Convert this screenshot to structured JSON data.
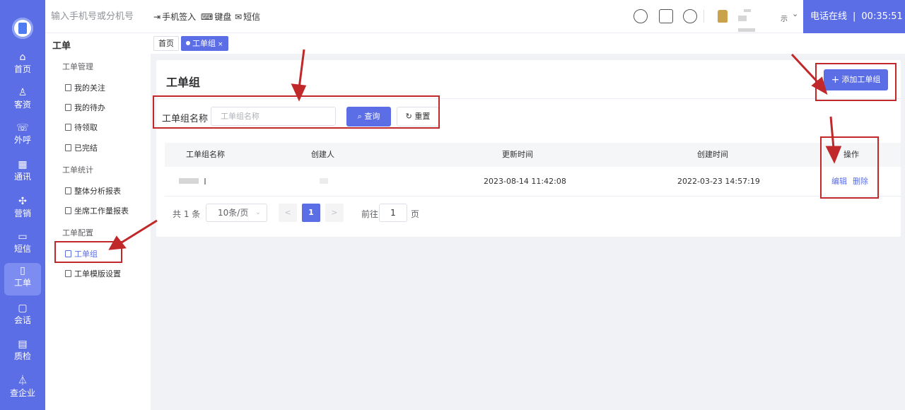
{
  "rail": {
    "items": [
      {
        "label": "首页",
        "icon": "home-icon"
      },
      {
        "label": "客资",
        "icon": "customer-icon"
      },
      {
        "label": "外呼",
        "icon": "outbound-call-icon"
      },
      {
        "label": "通讯",
        "icon": "contacts-icon"
      },
      {
        "label": "营销",
        "icon": "marketing-icon"
      },
      {
        "label": "短信",
        "icon": "sms-icon"
      },
      {
        "label": "工单",
        "icon": "ticket-icon",
        "active": true
      },
      {
        "label": "会话",
        "icon": "chat-icon"
      },
      {
        "label": "质检",
        "icon": "quality-check-icon"
      },
      {
        "label": "查企业",
        "icon": "company-search-icon"
      }
    ]
  },
  "topbar": {
    "phone_placeholder": "输入手机号或分机号",
    "phone_signin": "手机签入",
    "keyboard": "键盘",
    "sms": "短信",
    "user_suffix": "示",
    "status": "电话在线",
    "separator": "|",
    "timer": "00:35:51"
  },
  "menu": {
    "title": "工单",
    "groups": [
      {
        "label": "工单管理",
        "items": [
          "我的关注",
          "我的待办",
          "待领取",
          "已完结"
        ]
      },
      {
        "label": "工单统计",
        "items": [
          "整体分析报表",
          "坐席工作量报表"
        ]
      },
      {
        "label": "工单配置",
        "items": [
          "工单组",
          "工单模版设置"
        ]
      }
    ],
    "active_item": "工单组"
  },
  "tabs": [
    {
      "label": "首页"
    },
    {
      "label": "工单组",
      "active": true,
      "close": "×"
    }
  ],
  "page": {
    "title": "工单组",
    "add_button": "添加工单组",
    "filter_label": "工单组名称",
    "filter_placeholder": "工单组名称",
    "query_button": "查询",
    "reset_button": "重置"
  },
  "table": {
    "columns": [
      "工单组名称",
      "创建人",
      "更新时间",
      "创建时间",
      "操作"
    ],
    "rows": [
      {
        "updated": "2023-08-14 11:42:08",
        "created": "2022-03-23 14:57:19",
        "actions": [
          "编辑",
          "删除"
        ]
      }
    ]
  },
  "pagination": {
    "total": "共 1 条",
    "page_size": "10条/页",
    "prev": "<",
    "current": "1",
    "next": ">",
    "goto_label": "前往",
    "goto_value": "1",
    "goto_unit": "页"
  },
  "colors": {
    "accent": "#5b6ee6",
    "annotation": "#c0282a"
  }
}
